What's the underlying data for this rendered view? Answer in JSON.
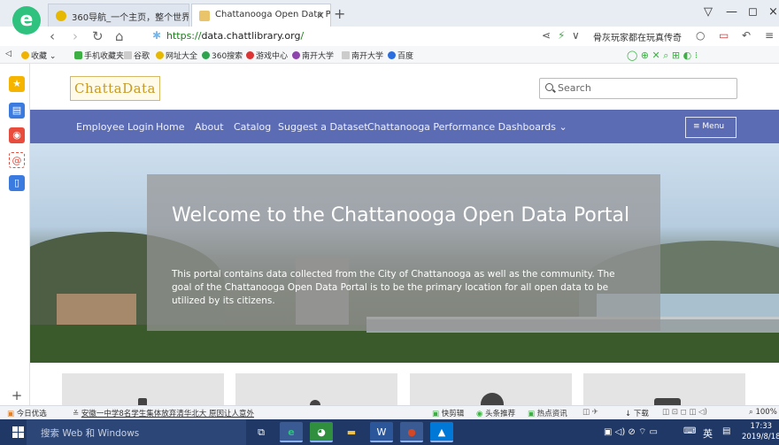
{
  "browser": {
    "tabs": [
      {
        "label": "360导航_一个主页，整个世界",
        "active": false
      },
      {
        "label": "Chattanooga Open Data Porta",
        "active": true
      }
    ],
    "new_tab_icon": "plus",
    "url_https": "https://",
    "url_host": "data.chattlibrary.org",
    "url_path": "/",
    "address_promo": "骨灰玩家都在玩真传奇",
    "bookmarks": [
      "收藏",
      "手机收藏夹",
      "谷歌",
      "网址大全",
      "360搜索",
      "游戏中心",
      "南开大学",
      "南开大学",
      "百度"
    ]
  },
  "site": {
    "logo_text": "ChattaData",
    "search_placeholder": "Search",
    "nav": [
      "Employee Login",
      "Home",
      "About",
      "Catalog",
      "Suggest a Dataset",
      "Chattanooga Performance Dashboards"
    ],
    "menu_label": "Menu",
    "hero_title": "Welcome to the Chattanooga Open Data Portal",
    "hero_text": "This portal contains data collected from the City of Chattanooga as well as the community. The goal of the Chattanooga Open Data Portal is to be the primary location for all open data to be utilized by its citizens."
  },
  "statusbar": {
    "left": "今日优选",
    "news": "安徽一中学8名学生集体放弃清华北大 原因让人意外",
    "items": [
      "快剪辑",
      "头条推荐",
      "热点资讯",
      "下载"
    ],
    "zoom": "100%"
  },
  "taskbar": {
    "search_placeholder": "搜索 Web 和 Windows",
    "ime": "英",
    "time": "17:33",
    "date": "2019/8/18"
  },
  "colors": {
    "navbar": "#5b6cb5",
    "taskbar": "#1f3866",
    "browser_accent": "#2ec27e"
  }
}
